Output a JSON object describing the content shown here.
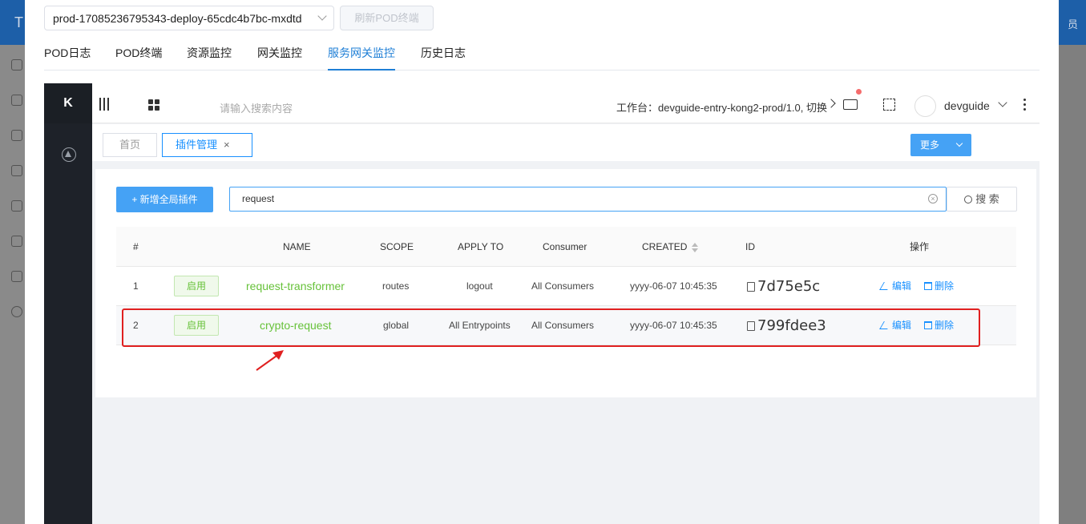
{
  "background": {
    "header_title": "T",
    "header_right": "员"
  },
  "modal": {
    "pod_select_value": "prod-17085236795343-deploy-65cdc4b7bc-mxdtd",
    "refresh_button": "刷新POD终端",
    "tabs": [
      {
        "label": "POD日志",
        "active": false
      },
      {
        "label": "POD终端",
        "active": false
      },
      {
        "label": "资源监控",
        "active": false
      },
      {
        "label": "网关监控",
        "active": false
      },
      {
        "label": "服务网关监控",
        "active": true
      },
      {
        "label": "历史日志",
        "active": false
      }
    ]
  },
  "kong": {
    "logo": "K",
    "search_placeholder": "请输入搜索内容",
    "workspace": "工作台：devguide-entry-kong2-prod/1.0, 切换",
    "username": "devguide",
    "page_tabs": [
      {
        "label": "首页",
        "active": false
      },
      {
        "label": "插件管理",
        "active": true,
        "close": "×"
      }
    ],
    "more_button": "更多",
    "add_button": "+ 新增全局插件",
    "search_value": "request",
    "search_button": "搜 索",
    "table": {
      "headers": [
        "#",
        "NAME",
        "SCOPE",
        "APPLY TO",
        "Consumer",
        "CREATED",
        "ID",
        "操作"
      ],
      "rows": [
        {
          "index": "1",
          "status": "启用",
          "name": "request-transformer",
          "scope": "routes",
          "apply_to": "logout",
          "consumer": "All Consumers",
          "created": "yyyy-06-07 10:45:35",
          "id": "7d75e5c",
          "edit": "编辑",
          "delete": "删除"
        },
        {
          "index": "2",
          "status": "启用",
          "name": "crypto-request",
          "scope": "global",
          "apply_to": "All Entrypoints",
          "consumer": "All Consumers",
          "created": "yyyy-06-07 10:45:35",
          "id": "799fdee3",
          "edit": "编辑",
          "delete": "删除"
        }
      ]
    }
  },
  "colors": {
    "accent": "#1890ff",
    "enabled_green": "#67c23a",
    "highlight_red": "#e02020"
  }
}
